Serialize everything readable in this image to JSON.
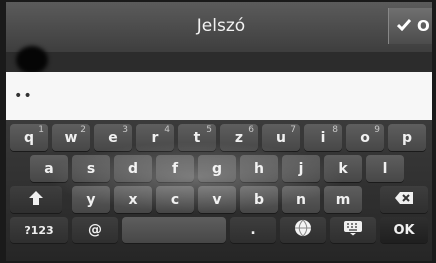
{
  "header": {
    "title": "Jelszó",
    "ok_label": "O"
  },
  "password_field": {
    "value": "••"
  },
  "keyboard": {
    "row1": [
      {
        "label": "q",
        "num": "1"
      },
      {
        "label": "w",
        "num": "2"
      },
      {
        "label": "e",
        "num": "3"
      },
      {
        "label": "r",
        "num": "4"
      },
      {
        "label": "t",
        "num": "5"
      },
      {
        "label": "z",
        "num": "6"
      },
      {
        "label": "u",
        "num": "7"
      },
      {
        "label": "i",
        "num": "8"
      },
      {
        "label": "o",
        "num": "9"
      },
      {
        "label": "p",
        "num": ""
      }
    ],
    "row2": [
      "a",
      "s",
      "d",
      "f",
      "g",
      "h",
      "j",
      "k",
      "l"
    ],
    "row3": [
      "y",
      "x",
      "c",
      "v",
      "b",
      "n",
      "m"
    ],
    "bottom": {
      "symbols": "?123",
      "at": "@",
      "dot": ".",
      "ok": "OK"
    },
    "icons": {
      "shift": "shift-icon",
      "backspace": "backspace-icon",
      "globe": "globe-icon",
      "keyboard_hide": "keyboard-icon",
      "check": "check-icon"
    }
  }
}
